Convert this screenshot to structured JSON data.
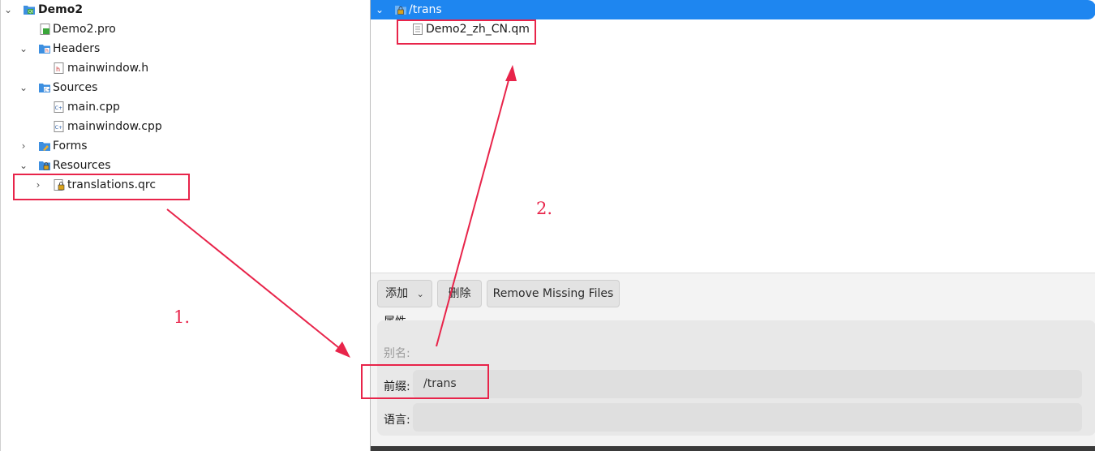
{
  "project_tree": {
    "root": "Demo2",
    "pro_file": "Demo2.pro",
    "headers": {
      "label": "Headers",
      "items": [
        "mainwindow.h"
      ]
    },
    "sources": {
      "label": "Sources",
      "items": [
        "main.cpp",
        "mainwindow.cpp"
      ]
    },
    "forms": {
      "label": "Forms"
    },
    "resources": {
      "label": "Resources",
      "items": [
        "translations.qrc"
      ]
    }
  },
  "resource_editor": {
    "prefix_node": "/trans",
    "file_node": "Demo2_zh_CN.qm",
    "buttons": {
      "add": "添加",
      "delete": "删除",
      "remove_missing": "Remove Missing Files"
    },
    "properties_title": "属性",
    "alias_label": "别名:",
    "alias_value": "",
    "prefix_label": "前缀:",
    "prefix_value": "/trans",
    "language_label": "语言:",
    "language_value": ""
  },
  "annotations": {
    "step1": "1.",
    "step2": "2."
  },
  "colors": {
    "selection": "#1e86f0",
    "annotation": "#e8244a"
  }
}
